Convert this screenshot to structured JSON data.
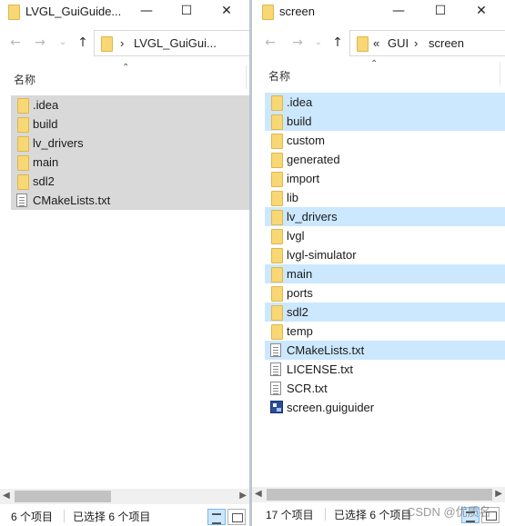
{
  "left": {
    "title": "LVGL_GuiGuide...",
    "address": [
      "LVGL_GuiGui..."
    ],
    "column_name": "名称",
    "items": [
      {
        "label": ".idea",
        "icon": "folder-icon",
        "selected": true
      },
      {
        "label": "build",
        "icon": "folder-icon",
        "selected": true
      },
      {
        "label": "lv_drivers",
        "icon": "folder-icon",
        "selected": true
      },
      {
        "label": "main",
        "icon": "folder-icon",
        "selected": true
      },
      {
        "label": "sdl2",
        "icon": "folder-icon",
        "selected": true
      },
      {
        "label": "CMakeLists.txt",
        "icon": "text-file-icon",
        "selected": true
      }
    ],
    "status": {
      "count": "6 个项目",
      "selected": "已选择 6 个项目"
    }
  },
  "right": {
    "title": "screen",
    "address": [
      "GUI",
      "screen"
    ],
    "column_name": "名称",
    "items": [
      {
        "label": ".idea",
        "icon": "folder-icon",
        "selected": true
      },
      {
        "label": "build",
        "icon": "folder-icon",
        "selected": true
      },
      {
        "label": "custom",
        "icon": "folder-icon",
        "selected": false
      },
      {
        "label": "generated",
        "icon": "folder-icon",
        "selected": false
      },
      {
        "label": "import",
        "icon": "folder-icon",
        "selected": false
      },
      {
        "label": "lib",
        "icon": "folder-icon",
        "selected": false
      },
      {
        "label": "lv_drivers",
        "icon": "folder-icon",
        "selected": true
      },
      {
        "label": "lvgl",
        "icon": "folder-icon",
        "selected": false
      },
      {
        "label": "lvgl-simulator",
        "icon": "folder-icon",
        "selected": false
      },
      {
        "label": "main",
        "icon": "folder-icon",
        "selected": true
      },
      {
        "label": "ports",
        "icon": "folder-icon",
        "selected": false
      },
      {
        "label": "sdl2",
        "icon": "folder-icon",
        "selected": true
      },
      {
        "label": "temp",
        "icon": "folder-icon",
        "selected": false
      },
      {
        "label": "CMakeLists.txt",
        "icon": "text-file-icon",
        "selected": true
      },
      {
        "label": "LICENSE.txt",
        "icon": "text-file-icon",
        "selected": false
      },
      {
        "label": "SCR.txt",
        "icon": "text-file-icon",
        "selected": false
      },
      {
        "label": "screen.guiguider",
        "icon": "guiguider-app-icon",
        "selected": false
      }
    ],
    "status": {
      "count": "17 个项目",
      "selected": "已选择 6 个项目"
    }
  },
  "watermark": "CSDN @优质名"
}
